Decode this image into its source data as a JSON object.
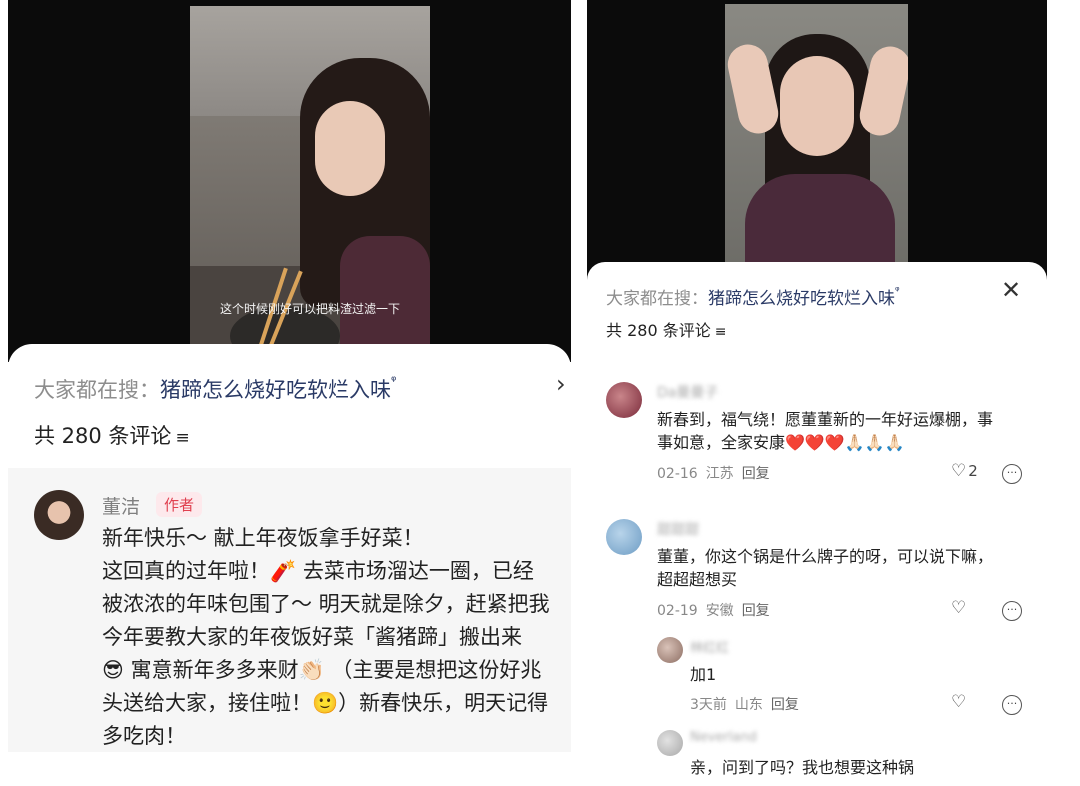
{
  "left": {
    "video_caption": "这个时候刚好可以把料渣过滤一下",
    "search_prefix": "大家都在搜：",
    "search_keyword": "猪蹄怎么烧好吃软烂入味",
    "search_icon": "search-icon",
    "chevron": "›",
    "comment_count": "共 280 条评论",
    "filter_icon": "≡",
    "author": {
      "name": "董洁",
      "tag": "作者",
      "lines": [
        "新年快乐～ 献上年夜饭拿手好菜！",
        "这回真的过年啦！🧨 去菜市场溜达一圈，已经",
        "被浓浓的年味包围了～ 明天就是除夕，赶紧把我",
        "今年要教大家的年夜饭好菜「酱猪蹄」搬出来",
        "😎 寓意新年多多来财👏🏻 （主要是想把这份好兆",
        "头送给大家，接住啦！🙂）新春快乐，明天记得",
        "多吃肉！"
      ]
    }
  },
  "right": {
    "search_prefix": "大家都在搜：",
    "search_keyword": "猪蹄怎么烧好吃软烂入味",
    "close_icon": "✕",
    "comment_count": "共 280 条评论",
    "filter_icon": "≡",
    "comments": [
      {
        "name": "Da曼曼子",
        "lines": [
          "新春到，福气绕！愿董董新的一年好运爆棚，事",
          "事如意，全家安康❤️❤️❤️🙏🏻🙏🏻🙏🏻"
        ],
        "date": "02-16",
        "location": "江苏",
        "reply": "回复",
        "likes": "2"
      },
      {
        "name": "甜甜甜",
        "lines": [
          "董董，你这个锅是什么牌子的呀，可以说下嘛，",
          "超超超想买"
        ],
        "date": "02-19",
        "location": "安徽",
        "reply": "回复",
        "likes": ""
      },
      {
        "name": "林红红",
        "lines": [
          "加1"
        ],
        "date": "3天前",
        "location": "山东",
        "reply": "回复",
        "likes": ""
      },
      {
        "name": "Neverland",
        "lines": [
          "亲，问到了吗？我也想要这种锅"
        ],
        "date": "",
        "location": "",
        "reply": "",
        "likes": ""
      }
    ]
  }
}
